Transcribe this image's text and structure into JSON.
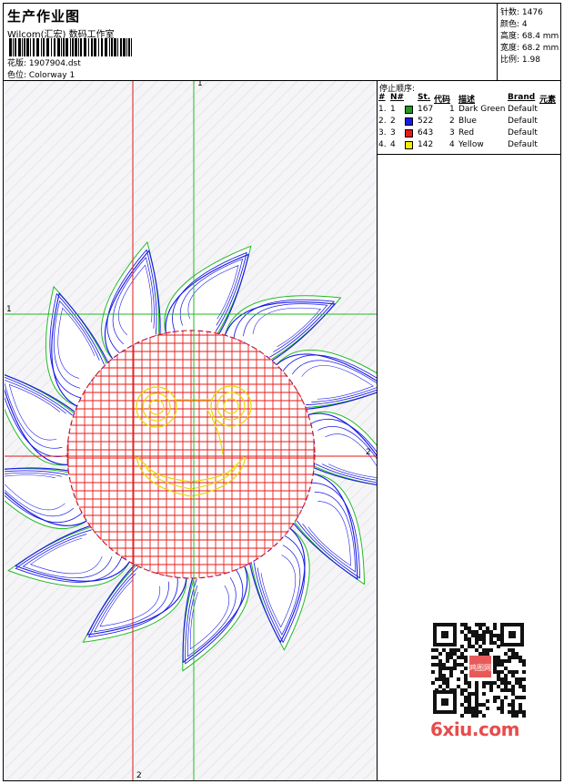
{
  "header": {
    "title": "生产作业图",
    "company": "Wilcom(汇宏) 数码工作室",
    "design_label": "花版: 1907904.dst",
    "colorway_label": "色位: Colorway 1"
  },
  "stats": {
    "stitches": "针数: 1476",
    "colors": "颜色: 4",
    "height": "高度: 68.4 mm",
    "width": "宽度: 68.2 mm",
    "scale": "比例: 1.98"
  },
  "stop_sequence": {
    "title": "停止顺序:",
    "columns": [
      "#",
      "N#",
      "St.",
      "代码",
      "描述",
      "Brand",
      "元素"
    ],
    "rows": [
      {
        "idx": "1.",
        "needle": "1",
        "color": "#1f9a1f",
        "stitches": "167",
        "code": "1",
        "desc": "Dark Green",
        "brand": "Default"
      },
      {
        "idx": "2.",
        "needle": "2",
        "color": "#1a1ae6",
        "stitches": "522",
        "code": "2",
        "desc": "Blue",
        "brand": "Default"
      },
      {
        "idx": "3.",
        "needle": "3",
        "color": "#e61a1a",
        "stitches": "643",
        "code": "3",
        "desc": "Red",
        "brand": "Default"
      },
      {
        "idx": "4.",
        "needle": "4",
        "color": "#f2f200",
        "stitches": "142",
        "code": "4",
        "desc": "Yellow",
        "brand": "Default"
      }
    ]
  },
  "axes": {
    "top": "1",
    "left": "1",
    "right": "2",
    "bottom": "2"
  },
  "watermark": {
    "brand": "6xiu.com",
    "seal": "鸡图网"
  },
  "colors": {
    "green": "#22bb22",
    "blue": "#1a1ae6",
    "red": "#e61a1a",
    "yellow": "#e8d800",
    "guide_red": "#e01818"
  }
}
